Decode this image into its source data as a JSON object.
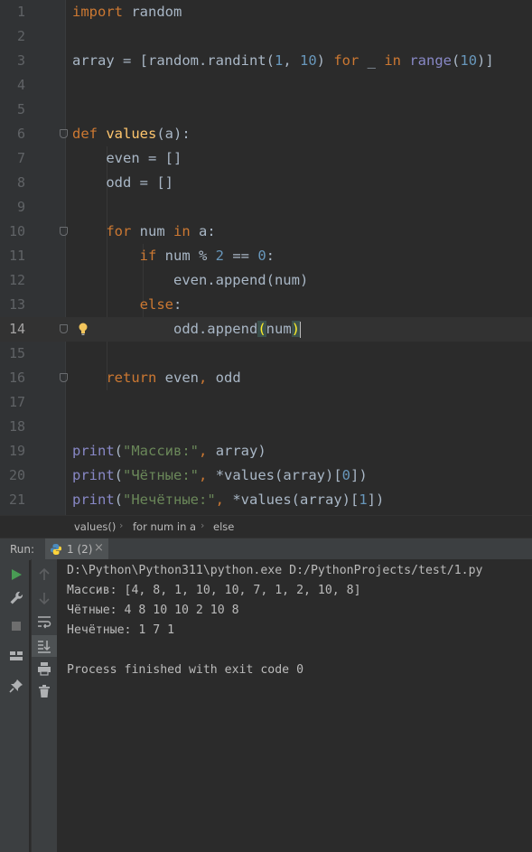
{
  "editor": {
    "line_numbers": [
      "1",
      "2",
      "3",
      "4",
      "5",
      "6",
      "7",
      "8",
      "9",
      "10",
      "11",
      "12",
      "13",
      "14",
      "15",
      "16",
      "17",
      "18",
      "19",
      "20",
      "21"
    ],
    "tokens": {
      "l1_import": "import",
      "l1_rest": " random",
      "l3_a": "array = [random.randint(",
      "l3_n1": "1",
      "l3_c": ", ",
      "l3_n2": "10",
      "l3_p": ") ",
      "l3_for": "for",
      "l3_us": " _ ",
      "l3_in": "in",
      "l3_sp": " ",
      "l3_range": "range",
      "l3_op": "(",
      "l3_n3": "10",
      "l3_end": ")]",
      "l6_def": "def",
      "l6_sp": " ",
      "l6_fn": "values",
      "l6_rest": "(a):",
      "l7": "    even = []",
      "l8": "    odd = []",
      "l10_ind": "    ",
      "l10_for": "for",
      "l10_mid": " num ",
      "l10_in": "in",
      "l10_end": " a:",
      "l11_ind": "        ",
      "l11_if": "if",
      "l11_mid": " num % ",
      "l11_n2": "2",
      "l11_eq": " == ",
      "l11_n0": "0",
      "l11_end": ":",
      "l12": "            even.append(num)",
      "l13_ind": "        ",
      "l13_else": "else",
      "l13_end": ":",
      "l14_a": "            odd.append",
      "l14_open": "(",
      "l14_arg": "num",
      "l14_close": ")",
      "l16_ind": "    ",
      "l16_ret": "return",
      "l16_rest": " even",
      "l16_comma": ",",
      "l16_odd": " odd",
      "l19_print": "print",
      "l19_o": "(",
      "l19_str": "\"Массив:\"",
      "l19_c": ",",
      "l19_rest": " array)",
      "l20_print": "print",
      "l20_o": "(",
      "l20_str": "\"Чётные:\"",
      "l20_c": ",",
      "l20_rest": " *values(array)[",
      "l20_n": "0",
      "l20_end": "])",
      "l21_print": "print",
      "l21_o": "(",
      "l21_str": "\"Нечётные:\"",
      "l21_c": ",",
      "l21_rest": " *values(array)[",
      "l21_n": "1",
      "l21_end": "])"
    }
  },
  "breadcrumb": [
    "values()",
    "for num in a",
    "else"
  ],
  "run": {
    "label": "Run:",
    "tab_label": "1 (2)",
    "tab_close": "×",
    "output": [
      "D:\\Python\\Python311\\python.exe D:/PythonProjects/test/1.py",
      "Массив: [4, 8, 1, 10, 10, 7, 1, 2, 10, 8]",
      "Чётные: 4 8 10 10 2 10 8",
      "Нечётные: 1 7 1",
      "",
      "Process finished with exit code 0"
    ]
  },
  "colors": {
    "keyword": "#cc7832",
    "number": "#6897bb",
    "string": "#6a8759",
    "function": "#ffc66d",
    "builtin": "#8888c6",
    "text": "#a9b7c6",
    "run_green": "#499c54"
  },
  "icons": [
    "fold-marker-icon",
    "bulb-icon",
    "python-icon",
    "run-icon",
    "wrench-icon",
    "stop-icon",
    "layout-icon",
    "pin-icon",
    "up-arrow-icon",
    "down-arrow-icon",
    "soft-wrap-icon",
    "scroll-to-end-icon",
    "print-icon",
    "trash-icon"
  ]
}
